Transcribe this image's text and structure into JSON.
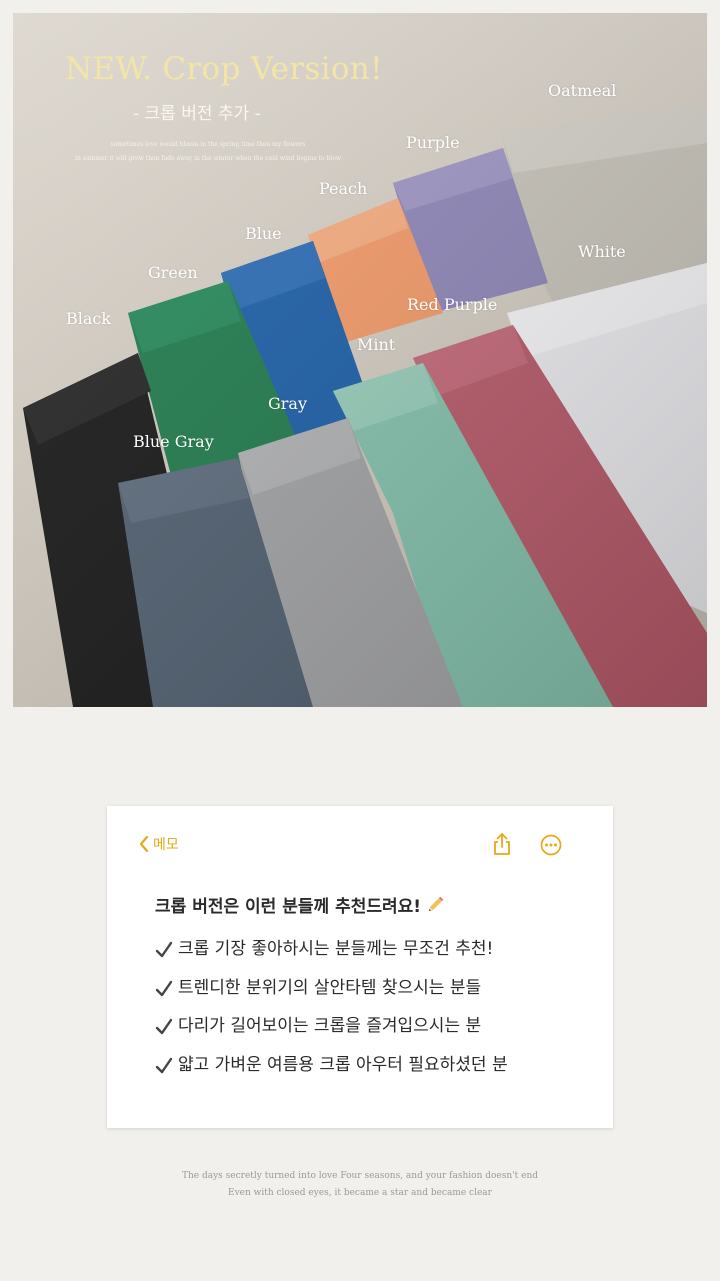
{
  "banner": {
    "headline": "NEW. Crop Version!",
    "subtitle": "- 크롭 버전 추가 -",
    "tagline_1": "sometimes love would bloom in the spring time then my flowers",
    "tagline_2": "in summer it will grow then fade away in the winter when the cold wind begins to blow",
    "colors": [
      {
        "label": "Oatmeal",
        "swatch": "#c7c3ba"
      },
      {
        "label": "Purple",
        "swatch": "#8e86b8"
      },
      {
        "label": "Peach",
        "swatch": "#f39a68"
      },
      {
        "label": "Blue",
        "swatch": "#1b5ea8"
      },
      {
        "label": "Green",
        "swatch": "#1f7a4c"
      },
      {
        "label": "White",
        "swatch": "#ececf0"
      },
      {
        "label": "Red Purple",
        "swatch": "#b85a6a"
      },
      {
        "label": "Mint",
        "swatch": "#85c2ad"
      },
      {
        "label": "Black",
        "swatch": "#161616"
      },
      {
        "label": "Gray",
        "swatch": "#a2a3a5"
      },
      {
        "label": "Blue Gray",
        "swatch": "#4f5f70"
      }
    ]
  },
  "memo": {
    "back_label": "메모",
    "share_icon": "share-icon",
    "more_icon": "more-icon",
    "accent": "#e6a817",
    "title": "크롭 버전은 이런 분들께 추천드려요!",
    "items": [
      "크롭 기장 좋아하시는 분들께는 무조건 추천!",
      "트렌디한 분위기의 살안타템 찾으시는 분들",
      "다리가 길어보이는 크롭을 즐겨입으시는 분",
      "얇고 가벼운 여름용 크롭 아우터 필요하셨던 분"
    ]
  },
  "footer": {
    "line_1": "The days secretly turned into love Four seasons, and your fashion doesn't end",
    "line_2": "Even with closed eyes, it became a star and became clear"
  }
}
